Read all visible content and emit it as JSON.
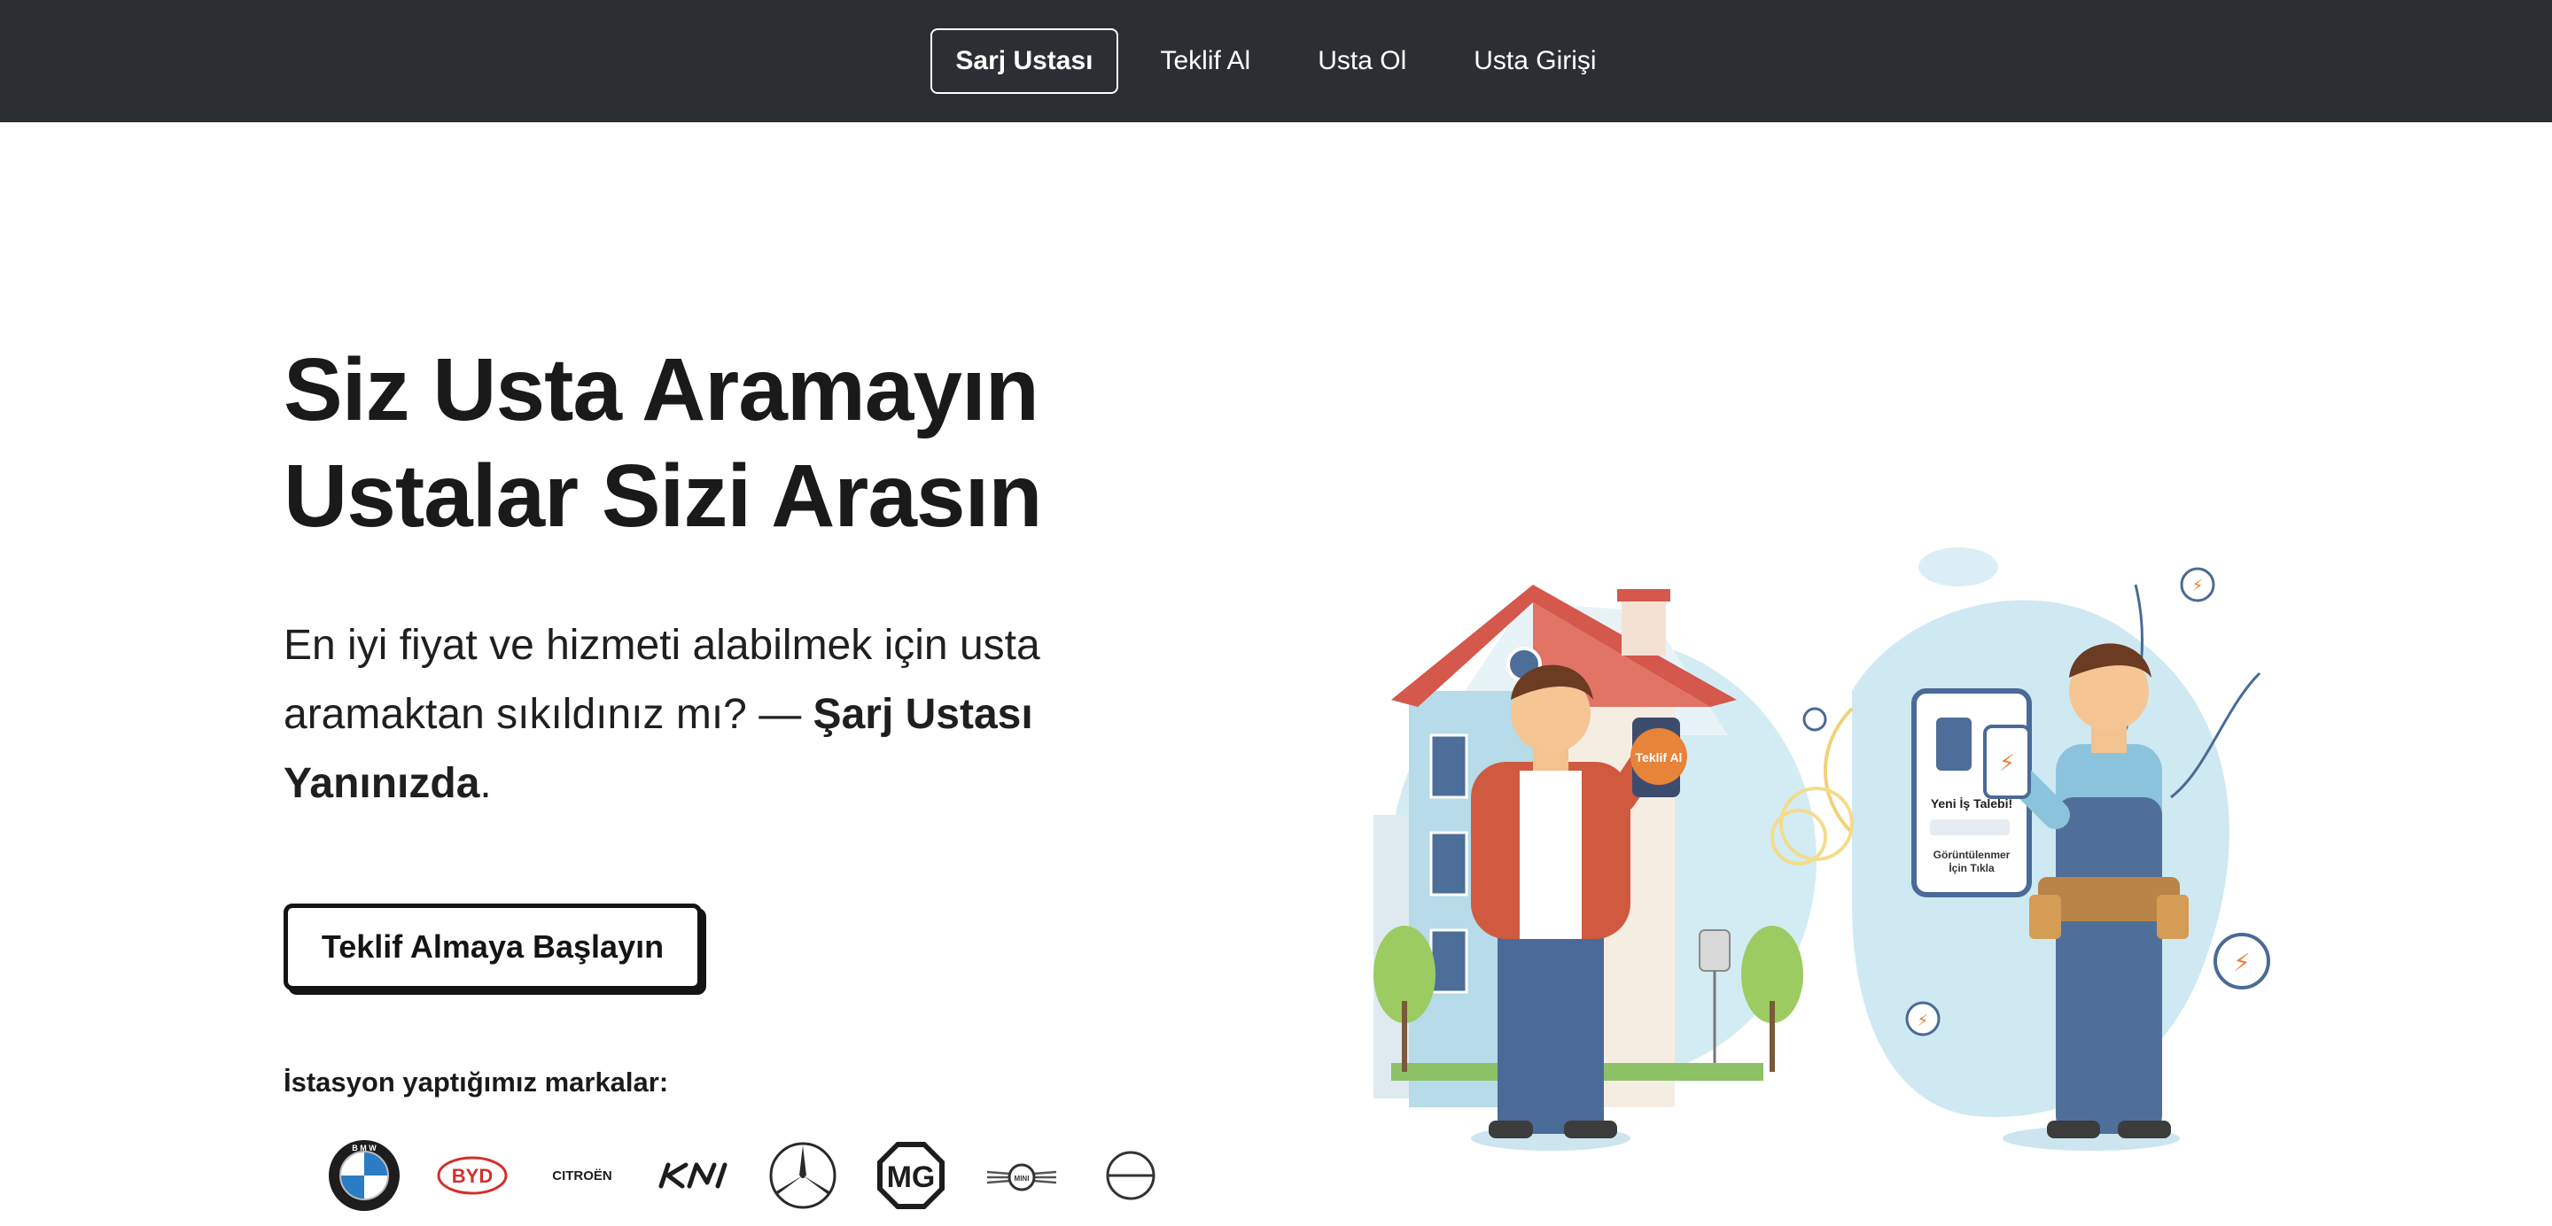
{
  "nav": {
    "items": [
      {
        "label": "Sarj Ustası",
        "active": true
      },
      {
        "label": "Teklif Al",
        "active": false
      },
      {
        "label": "Usta Ol",
        "active": false
      },
      {
        "label": "Usta Girişi",
        "active": false
      }
    ]
  },
  "hero": {
    "title_line1": "Siz Usta Aramayın",
    "title_line2": "Ustalar Sizi Arasın",
    "subtitle_part1": "En iyi fiyat ve hizmeti alabilmek için usta aramaktan sıkıldınız mı? — ",
    "subtitle_bold": "Şarj Ustası Yanınızda",
    "subtitle_end": ".",
    "cta_label": "Teklif Almaya Başlayın",
    "brands_label": "İstasyon yaptığımız markalar:"
  },
  "brands": [
    "bmw-logo",
    "byd-logo",
    "citroen-logo",
    "kia-logo",
    "mercedes-logo",
    "mg-logo",
    "mini-logo",
    "partial-logo"
  ],
  "brand_texts": {
    "byd": "BYD",
    "citroen": "CITROËN",
    "kia": "KIA",
    "mg": "MG",
    "mini": "MINI",
    "bmw": "BMW"
  },
  "illustration": {
    "phone_badge": "Teklif Al",
    "new_request": "Yeni İş Talebi!",
    "hidden_text": "Görüntülenmer İçin Tıkla"
  },
  "colors": {
    "navbar_bg": "#2b2f33",
    "text": "#1a1a1a",
    "accent_orange": "#e8833a",
    "roof_red": "#d9554a",
    "sky_blue": "#cfe9f2",
    "overall_blue": "#4f6f9a"
  }
}
